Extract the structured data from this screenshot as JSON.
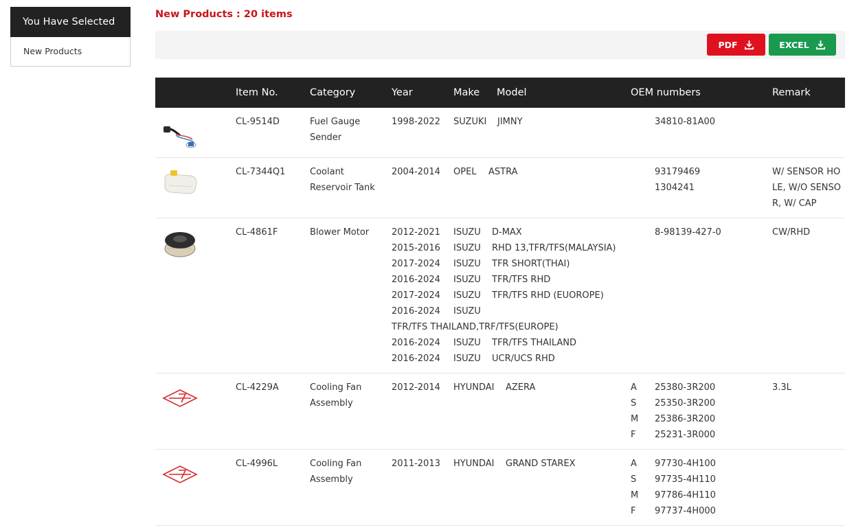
{
  "sidebar": {
    "heading": "You Have Selected",
    "selected": "New Products"
  },
  "title": "New Products : 20 items",
  "toolbar": {
    "pdf_label": "PDF",
    "excel_label": "EXCEL"
  },
  "colors": {
    "title": "#c9141a",
    "pdf": "#e0111e",
    "excel": "#1a9a4e",
    "header_bg": "#222222"
  },
  "table": {
    "headers": {
      "item": "Item No.",
      "category": "Category",
      "year": "Year",
      "make": "Make",
      "model": "Model",
      "oem": "OEM numbers",
      "remark": "Remark"
    },
    "rows": [
      {
        "image": "fuel-gauge-sender-image",
        "item": "CL-9514D",
        "category": [
          "Fuel Gauge",
          "Sender"
        ],
        "apps": [
          {
            "year": "1998-2022",
            "make": "SUZUKI",
            "model": "JIMNY"
          }
        ],
        "oem": [
          {
            "code": "",
            "number": "34810-81A00"
          }
        ],
        "remark": []
      },
      {
        "image": "coolant-reservoir-tank-image",
        "item": "CL-7344Q1",
        "category": [
          "Coolant",
          "Reservoir Tank"
        ],
        "apps": [
          {
            "year": "2004-2014",
            "make": "OPEL",
            "model": "ASTRA"
          }
        ],
        "oem": [
          {
            "code": "",
            "number": "93179469"
          },
          {
            "code": "",
            "number": "1304241"
          }
        ],
        "remark": [
          "W/ SENSOR HO",
          "LE, W/O SENSO",
          "R, W/ CAP"
        ]
      },
      {
        "image": "blower-motor-image",
        "item": "CL-4861F",
        "category": [
          "Blower Motor"
        ],
        "apps": [
          {
            "year": "2012-2021",
            "make": "ISUZU",
            "model": "D-MAX"
          },
          {
            "year": "2015-2016",
            "make": "ISUZU",
            "model": "RHD 13,TFR/TFS(MALAYSIA)"
          },
          {
            "year": "2017-2024",
            "make": "ISUZU",
            "model": "TFR SHORT(THAI)"
          },
          {
            "year": "2016-2024",
            "make": "ISUZU",
            "model": "TFR/TFS RHD"
          },
          {
            "year": "2017-2024",
            "make": "ISUZU",
            "model": "TFR/TFS RHD (EUOROPE)"
          },
          {
            "year": "2016-2024",
            "make": "ISUZU",
            "model": ""
          },
          {
            "year": "TFR/TFS THAILAND,TRF/TFS(EUROPE)",
            "make": "",
            "model": ""
          },
          {
            "year": "2016-2024",
            "make": "ISUZU",
            "model": "TFR/TFS THAILAND"
          },
          {
            "year": "2016-2024",
            "make": "ISUZU",
            "model": "UCR/UCS RHD"
          }
        ],
        "oem": [
          {
            "code": "",
            "number": "8-98139-427-0"
          }
        ],
        "remark": [
          "CW/RHD"
        ]
      },
      {
        "image": "no-image-logo",
        "item": "CL-4229A",
        "category": [
          "Cooling Fan",
          "Assembly"
        ],
        "apps": [
          {
            "year": "2012-2014",
            "make": "HYUNDAI",
            "model": "AZERA"
          }
        ],
        "oem": [
          {
            "code": "A",
            "number": "25380-3R200"
          },
          {
            "code": "S",
            "number": "25350-3R200"
          },
          {
            "code": "M",
            "number": "25386-3R200"
          },
          {
            "code": "F",
            "number": "25231-3R000"
          }
        ],
        "remark": [
          "3.3L"
        ]
      },
      {
        "image": "no-image-logo",
        "item": "CL-4996L",
        "category": [
          "Cooling Fan",
          "Assembly"
        ],
        "apps": [
          {
            "year": "2011-2013",
            "make": "HYUNDAI",
            "model": "GRAND STAREX"
          }
        ],
        "oem": [
          {
            "code": "A",
            "number": "97730-4H100"
          },
          {
            "code": "S",
            "number": "97735-4H110"
          },
          {
            "code": "M",
            "number": "97786-4H110"
          },
          {
            "code": "F",
            "number": "97737-4H000"
          }
        ],
        "remark": []
      }
    ]
  }
}
